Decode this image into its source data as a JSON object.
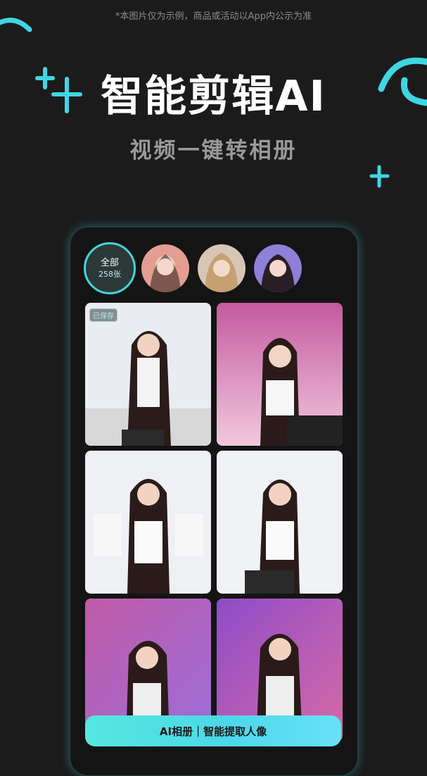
{
  "header": {
    "disclaimer": "*本图片仅为示例，商品或活动以App内公示为准",
    "title": "智能剪辑AI",
    "subtitle": "视频一键转相册"
  },
  "album": {
    "all_label": "全部",
    "all_count": "258张",
    "saved_badge": "已保存",
    "cta_label": "AI相册｜智能提取人像"
  },
  "colors": {
    "accent": "#43d4d8",
    "background": "#1b1b1b"
  }
}
